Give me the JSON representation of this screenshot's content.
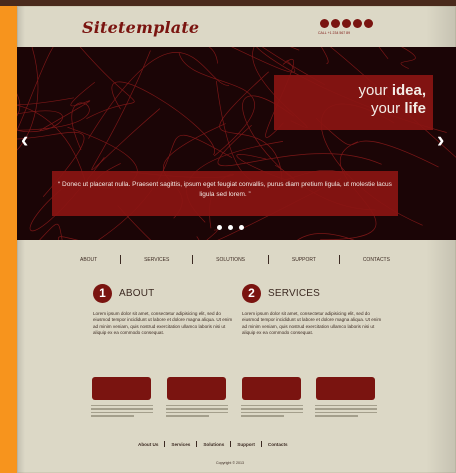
{
  "header": {
    "logo": "Sitetemplate",
    "contact": "CALL +1 234 567 89",
    "social_icons": [
      "social-icon-1",
      "social-icon-2",
      "social-icon-3",
      "social-icon-4",
      "social-icon-5"
    ]
  },
  "slider": {
    "headline_line1_prefix": "your ",
    "headline_line1_bold": "idea,",
    "headline_line2_prefix": "your ",
    "headline_line2_bold": "life",
    "quote": "“ Donec ut placerat nulla. Praesent sagittis, ipsum eget feugiat convallis, purus diam pretium ligula, ut molestie lacus ligula sed lorem. ”",
    "prev_arrow": "‹",
    "next_arrow": "›",
    "dots": 3
  },
  "nav": {
    "items": [
      "ABOUT",
      "SERVICES",
      "SOLUTIONS",
      "SUPPORT",
      "CONTACTS"
    ]
  },
  "sections": [
    {
      "number": "1",
      "title": "ABOUT",
      "text": "Lorem ipsum dolor sit amet, consectetur adipisicing elit, sed do eiusmod tempor incididunt ut labore et dolore magna aliqua. Ut enim ad minim veniam, quis nostrud exercitation ullamco laboris nisi ut aliquip ex ea commodo consequat."
    },
    {
      "number": "2",
      "title": "SERVICES",
      "text": "Lorem ipsum dolor sit amet, consectetur adipisicing elit, sed do eiusmod tempor incididunt ut labore et dolore magna aliqua. Ut enim ad minim veniam, quis nostrud exercitation ullamco laboris nisi ut aliquip ex ea commodo consequat."
    }
  ],
  "footer": {
    "links": [
      "About Us",
      "Services",
      "Solutions",
      "Support",
      "Contacts"
    ],
    "copyright": "Copyright © 2013"
  },
  "colors": {
    "accent": "#7a1410",
    "page_bg": "#dcd8c6",
    "outer_bg": "#f7941d",
    "slider_bg": "#1b0506"
  }
}
